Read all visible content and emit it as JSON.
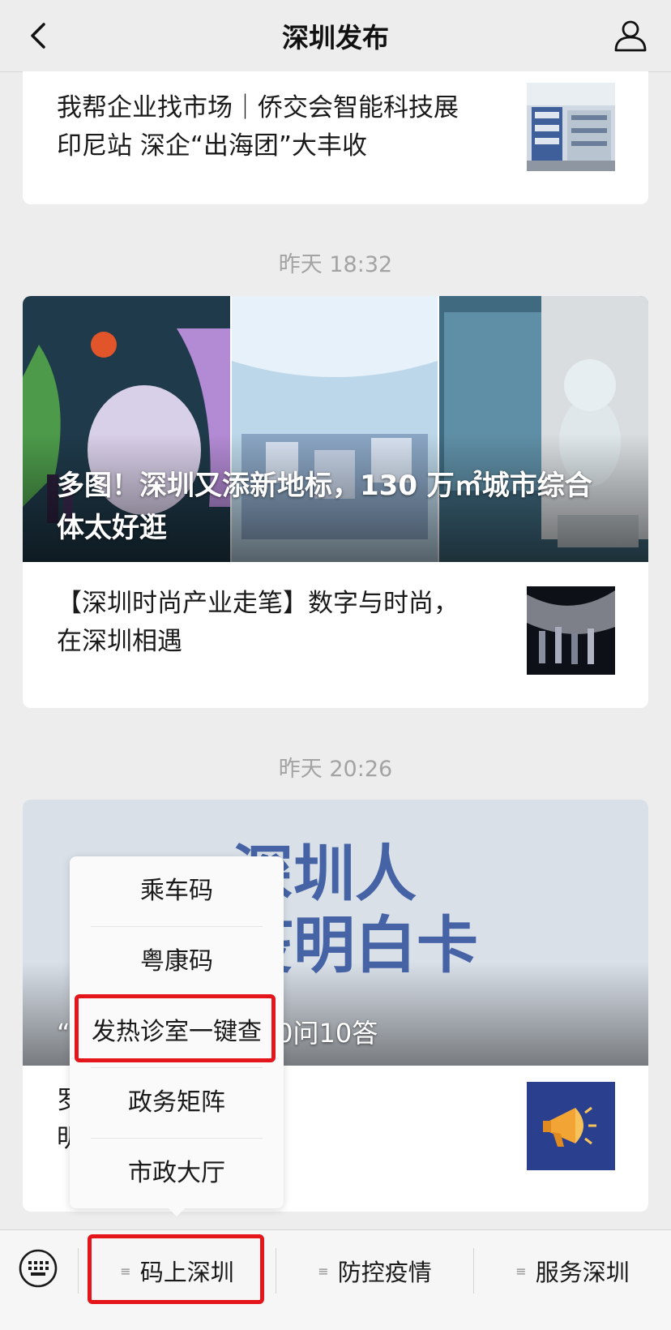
{
  "header": {
    "title": "深圳发布"
  },
  "articles": [
    {
      "title_line1": "我帮企业找市场｜侨交会智能科技展",
      "title_line2": "印尼站 深企“出海团”大丰收"
    }
  ],
  "time_groups": [
    {
      "time": "昨天 18:32",
      "hero_caption_line1": "多图！深圳又添新地标，130 万㎡城市综合",
      "hero_caption_line2": "体太好逛",
      "sub_title_line1": "【深圳时尚产业走笔】数字与时尚，",
      "sub_title_line2": "在深圳相遇"
    },
    {
      "time": "昨天 20:26",
      "hero_big_line1": "深圳人",
      "hero_big_line2": "疫明白卡",
      "hero_caption": "“            圳防疫明白卡，10问10答",
      "sub_title_line1": "罗                  宝安、大鹏防疫",
      "sub_title_line2": "明                  ！"
    }
  ],
  "popup_menu": {
    "items": [
      "乘车码",
      "粤康码",
      "发热诊室一键查",
      "政务矩阵",
      "市政大厅"
    ],
    "highlighted_index": 2
  },
  "bottom_menu": {
    "tabs": [
      {
        "label": "码上深圳",
        "highlighted": true
      },
      {
        "label": "防控疫情",
        "highlighted": false
      },
      {
        "label": "服务深圳",
        "highlighted": false
      }
    ]
  },
  "colors": {
    "highlight_red": "#e4161c",
    "background": "#ededed",
    "poster_blue": "#2d4f9a"
  }
}
